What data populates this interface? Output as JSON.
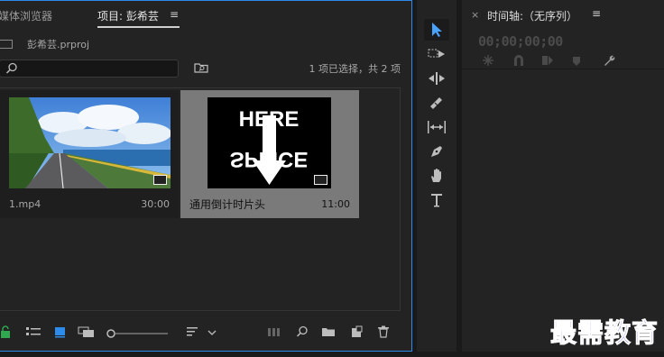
{
  "project_panel": {
    "tabs": {
      "media_browser": "媒体浏览器",
      "project": "项目: 彭希芸"
    },
    "menu_icon": "≡",
    "project_file": "彭希芸.prproj",
    "search": {
      "placeholder": "",
      "value": ""
    },
    "selection_status": "1 项已选择，共 2 项",
    "clips": [
      {
        "name": "1.mp4",
        "duration": "30:00",
        "selected": false
      },
      {
        "name": "通用倒计时片头",
        "duration": "11:00",
        "selected": true,
        "thumb_lines": [
          "HERE",
          "SPLICE"
        ]
      }
    ],
    "toolbar_icons": [
      "lock-icon",
      "list-view-icon",
      "icon-view-icon",
      "freeform-view-icon",
      "zoom-slider",
      "sort-icon",
      "chevron-down-icon",
      "automate-to-sequence-icon",
      "find-icon",
      "new-bin-icon",
      "new-item-icon",
      "clear-icon"
    ]
  },
  "tools_panel": {
    "tools": [
      "selection-tool",
      "track-select-tool",
      "ripple-edit-tool",
      "razor-tool",
      "slip-tool",
      "pen-tool",
      "hand-tool",
      "type-tool"
    ]
  },
  "timeline_panel": {
    "close": "×",
    "title": "时间轴:（无序列）",
    "menu_icon": "≡",
    "timecode": "00;00;00;00"
  },
  "watermark": "最需教育",
  "colors": {
    "accent": "#2d8ceb",
    "selection_tool": "#4aa2ff",
    "lock_green": "#2fa84f",
    "watermark": "#2a2ad8"
  }
}
